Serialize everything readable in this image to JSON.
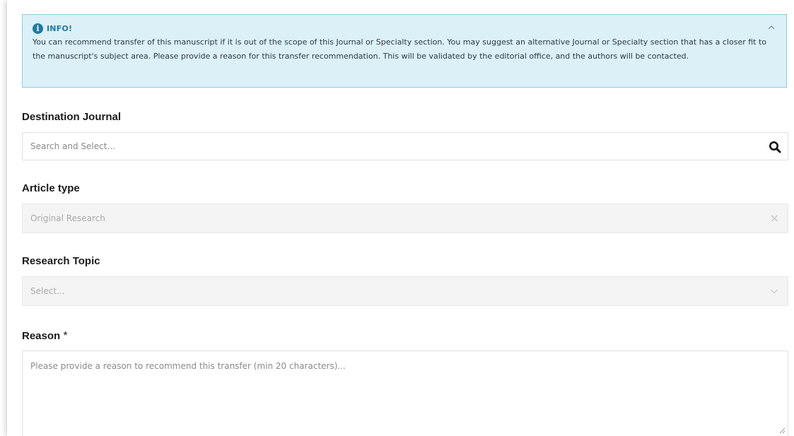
{
  "info": {
    "title": "INFO!",
    "body": "You can recommend transfer of this manuscript if it is out of the scope of this Journal or Specialty section. You may suggest an alternative Journal or Specialty section that has a closer fit to the manuscript's subject area. Please provide a reason for this transfer recommendation. This will be validated by the editorial office, and the authors will be contacted."
  },
  "destination_journal": {
    "label": "Destination Journal",
    "placeholder": "Search and Select..."
  },
  "article_type": {
    "label": "Article type",
    "value": "Original Research"
  },
  "research_topic": {
    "label": "Research Topic",
    "placeholder": "Select..."
  },
  "reason": {
    "label": "Reason",
    "required_marker": "*",
    "placeholder": "Please provide a reason to recommend this transfer (min 20 characters)..."
  },
  "colors": {
    "info_bg": "#dcf0f8",
    "info_border": "#8fcbe2",
    "info_accent": "#1d79a6"
  }
}
